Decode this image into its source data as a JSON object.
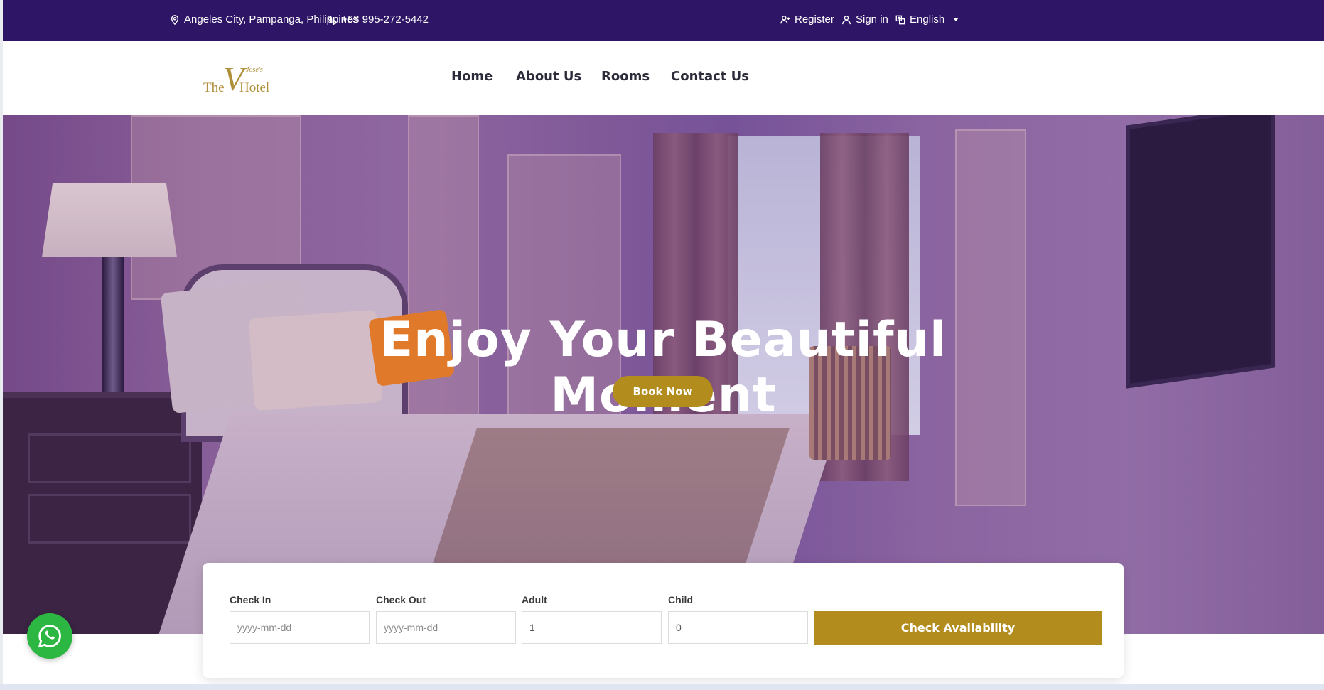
{
  "topbar": {
    "address": "Angeles City, Pampanga, Philippines",
    "phone": "+63 995-272-5442",
    "register": "Register",
    "signin": "Sign in",
    "language": "English"
  },
  "header": {
    "logo": {
      "the": "The",
      "v": "V",
      "hotel": "Hotel",
      "script": "Jose's"
    },
    "nav": [
      "Home",
      "About Us",
      "Rooms",
      "Contact Us"
    ]
  },
  "hero": {
    "title_line1": "Enjoy Your Beautiful",
    "title_line2": "Moment",
    "book_now": "Book Now"
  },
  "booking": {
    "check_in": {
      "label": "Check In",
      "placeholder": "yyyy-mm-dd",
      "value": ""
    },
    "check_out": {
      "label": "Check Out",
      "placeholder": "yyyy-mm-dd",
      "value": ""
    },
    "adult": {
      "label": "Adult",
      "value": "1"
    },
    "child": {
      "label": "Child",
      "value": "0"
    },
    "button": "Check Availability"
  },
  "colors": {
    "topbar": "#2e1566",
    "accent": "#b38c1e",
    "whatsapp": "#2cb742"
  },
  "icons": {
    "address": "map-pin-icon",
    "phone": "phone-icon",
    "register": "user-plus-icon",
    "signin": "user-icon",
    "language": "translate-icon",
    "chat": "whatsapp-icon"
  }
}
